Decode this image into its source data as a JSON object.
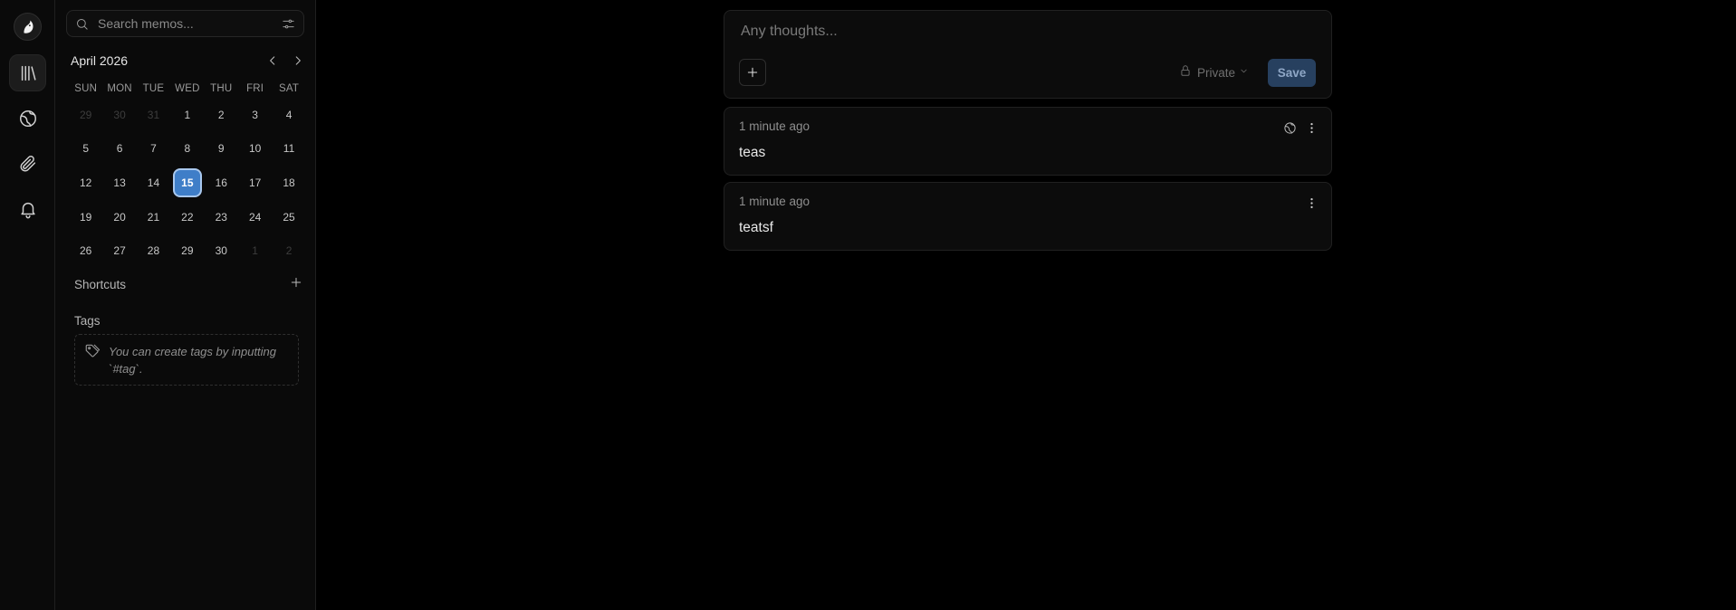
{
  "rail": {
    "items": [
      {
        "name": "home",
        "icon": "library-icon",
        "active": true
      },
      {
        "name": "explore",
        "icon": "globe-icon",
        "active": false
      },
      {
        "name": "attachments",
        "icon": "paperclip-icon",
        "active": false
      },
      {
        "name": "inbox",
        "icon": "bell-icon",
        "active": false
      }
    ]
  },
  "sidebar": {
    "search_placeholder": "Search memos...",
    "calendar": {
      "month_label": "April 2026",
      "weekdays": [
        "SUN",
        "MON",
        "TUE",
        "WED",
        "THU",
        "FRI",
        "SAT"
      ],
      "days": [
        {
          "label": "29",
          "muted": true
        },
        {
          "label": "30",
          "muted": true
        },
        {
          "label": "31",
          "muted": true
        },
        {
          "label": "1"
        },
        {
          "label": "2"
        },
        {
          "label": "3"
        },
        {
          "label": "4"
        },
        {
          "label": "5"
        },
        {
          "label": "6"
        },
        {
          "label": "7"
        },
        {
          "label": "8"
        },
        {
          "label": "9"
        },
        {
          "label": "10"
        },
        {
          "label": "11"
        },
        {
          "label": "12"
        },
        {
          "label": "13"
        },
        {
          "label": "14"
        },
        {
          "label": "15",
          "today": true
        },
        {
          "label": "16"
        },
        {
          "label": "17"
        },
        {
          "label": "18"
        },
        {
          "label": "19"
        },
        {
          "label": "20"
        },
        {
          "label": "21"
        },
        {
          "label": "22"
        },
        {
          "label": "23"
        },
        {
          "label": "24"
        },
        {
          "label": "25"
        },
        {
          "label": "26"
        },
        {
          "label": "27"
        },
        {
          "label": "28"
        },
        {
          "label": "29"
        },
        {
          "label": "30"
        },
        {
          "label": "1",
          "muted": true
        },
        {
          "label": "2",
          "muted": true
        }
      ]
    },
    "shortcuts_label": "Shortcuts",
    "tags_label": "Tags",
    "tags_hint": "You can create tags by inputting `#tag`."
  },
  "editor": {
    "placeholder": "Any thoughts...",
    "visibility": "Private",
    "save_label": "Save"
  },
  "memos": [
    {
      "time": "1 minute ago",
      "content": "teas",
      "has_visibility_icon": true
    },
    {
      "time": "1 minute ago",
      "content": "teatsf",
      "has_visibility_icon": false
    }
  ],
  "colors": {
    "accent": "#3f7ec8",
    "save_button": "#27405f",
    "background": "#000000",
    "panel": "#0a0a0a"
  }
}
